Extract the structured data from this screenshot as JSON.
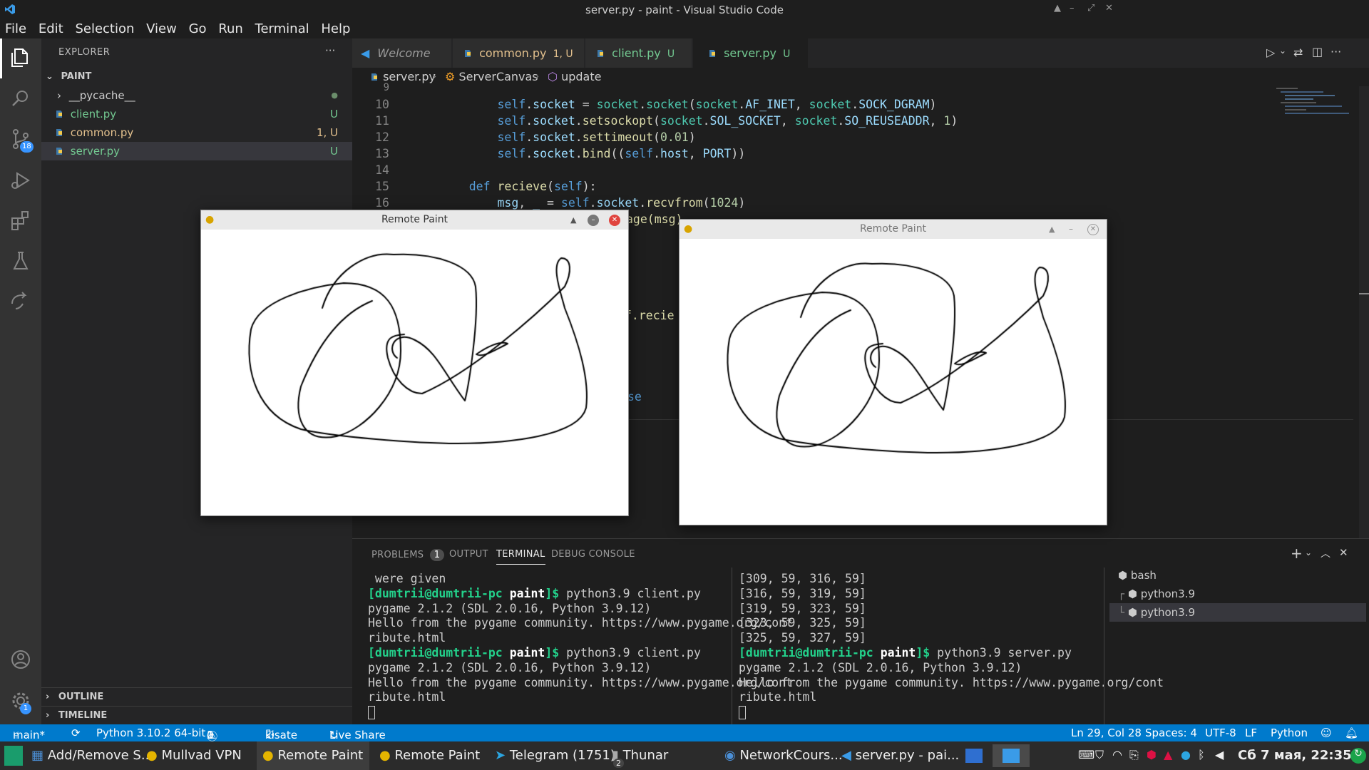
{
  "window": {
    "title": "server.py - paint - Visual Studio Code"
  },
  "menu": [
    "File",
    "Edit",
    "Selection",
    "View",
    "Go",
    "Run",
    "Terminal",
    "Help"
  ],
  "activity": {
    "scm_badge": "18",
    "settings_badge": "1"
  },
  "sidebar": {
    "header": "EXPLORER",
    "more": "···",
    "folder": "PAINT",
    "items": [
      {
        "label": "__pycache__",
        "status": ""
      },
      {
        "label": "client.py",
        "status": "U"
      },
      {
        "label": "common.py",
        "status": "1, U"
      },
      {
        "label": "server.py",
        "status": "U"
      }
    ],
    "outline": "OUTLINE",
    "timeline": "TIMELINE"
  },
  "tabs": [
    {
      "label": "Welcome",
      "status": ""
    },
    {
      "label": "common.py",
      "status": "1, U"
    },
    {
      "label": "client.py",
      "status": "U"
    },
    {
      "label": "server.py",
      "status": "U"
    }
  ],
  "breadcrumb": [
    "server.py",
    "ServerCanvas",
    "update"
  ],
  "code": {
    "lines": [
      {
        "n": "9",
        "t": ""
      },
      {
        "n": "10",
        "t": "        self.socket = socket.socket(socket.AF_INET, socket.SOCK_DGRAM)"
      },
      {
        "n": "11",
        "t": "        self.socket.setsockopt(socket.SOL_SOCKET, socket.SO_REUSEADDR, 1)"
      },
      {
        "n": "12",
        "t": "        self.socket.settimeout(0.01)"
      },
      {
        "n": "13",
        "t": "        self.socket.bind((self.host, PORT))"
      },
      {
        "n": "14",
        "t": ""
      },
      {
        "n": "15",
        "t": "    def recieve(self):"
      },
      {
        "n": "16",
        "t": "        msg, _ = self.socket.recvfrom(1024)"
      }
    ],
    "peek1": "age(msg)",
    "peek2": "f.recie",
    "peek3": "se"
  },
  "panel": {
    "tabs": [
      "PROBLEMS",
      "OUTPUT",
      "TERMINAL",
      "DEBUG CONSOLE"
    ],
    "problems_count": "1",
    "left_terminal": [
      {
        "type": "plain",
        "text": " were given"
      },
      {
        "type": "prompt",
        "user": "[dumtrii@dumtrii-pc ",
        "dir": "paint",
        "end": "]$ ",
        "cmd": "python3.9 client.py"
      },
      {
        "type": "plain",
        "text": "pygame 2.1.2 (SDL 2.0.16, Python 3.9.12)"
      },
      {
        "type": "plain",
        "text": "Hello from the pygame community. https://www.pygame.org/cont"
      },
      {
        "type": "plain",
        "text": "ribute.html"
      },
      {
        "type": "prompt",
        "user": "[dumtrii@dumtrii-pc ",
        "dir": "paint",
        "end": "]$ ",
        "cmd": "python3.9 client.py"
      },
      {
        "type": "plain",
        "text": "pygame 2.1.2 (SDL 2.0.16, Python 3.9.12)"
      },
      {
        "type": "plain",
        "text": "Hello from the pygame community. https://www.pygame.org/cont"
      },
      {
        "type": "plain",
        "text": "ribute.html"
      }
    ],
    "right_terminal": [
      {
        "type": "plain",
        "text": "[309, 59, 316, 59]"
      },
      {
        "type": "plain",
        "text": "[316, 59, 319, 59]"
      },
      {
        "type": "plain",
        "text": "[319, 59, 323, 59]"
      },
      {
        "type": "plain",
        "text": "[323, 59, 325, 59]"
      },
      {
        "type": "plain",
        "text": "[325, 59, 327, 59]"
      },
      {
        "type": "prompt",
        "user": "[dumtrii@dumtrii-pc ",
        "dir": "paint",
        "end": "]$ ",
        "cmd": "python3.9 server.py"
      },
      {
        "type": "plain",
        "text": "pygame 2.1.2 (SDL 2.0.16, Python 3.9.12)"
      },
      {
        "type": "plain",
        "text": "Hello from the pygame community. https://www.pygame.org/cont"
      },
      {
        "type": "plain",
        "text": "ribute.html"
      }
    ],
    "terminals": [
      "bash",
      "python3.9",
      "python3.9"
    ]
  },
  "paint_windows": [
    {
      "title": "Remote Paint"
    },
    {
      "title": "Remote Paint"
    }
  ],
  "status": {
    "branch": "main*",
    "python": "Python 3.10.2 64-bit",
    "errors": "0",
    "warnings": "1",
    "user": "kisate",
    "liveshare": "Live Share",
    "position": "Ln 29, Col 28",
    "spaces": "Spaces: 4",
    "encoding": "UTF-8",
    "eol": "LF",
    "language": "Python"
  },
  "taskbar": {
    "items": [
      "Add/Remove S...",
      "Mullvad VPN",
      "Remote Paint",
      "Remote Paint",
      "Telegram (1751)",
      "Thunar",
      "NetworkCours...",
      "server.py - pai..."
    ],
    "thunar_badge": "2",
    "clock": "Сб  7 мая, 22:35"
  },
  "colors": {
    "accent": "#007acc",
    "untracked": "#73c991",
    "modified": "#e2c08d"
  }
}
